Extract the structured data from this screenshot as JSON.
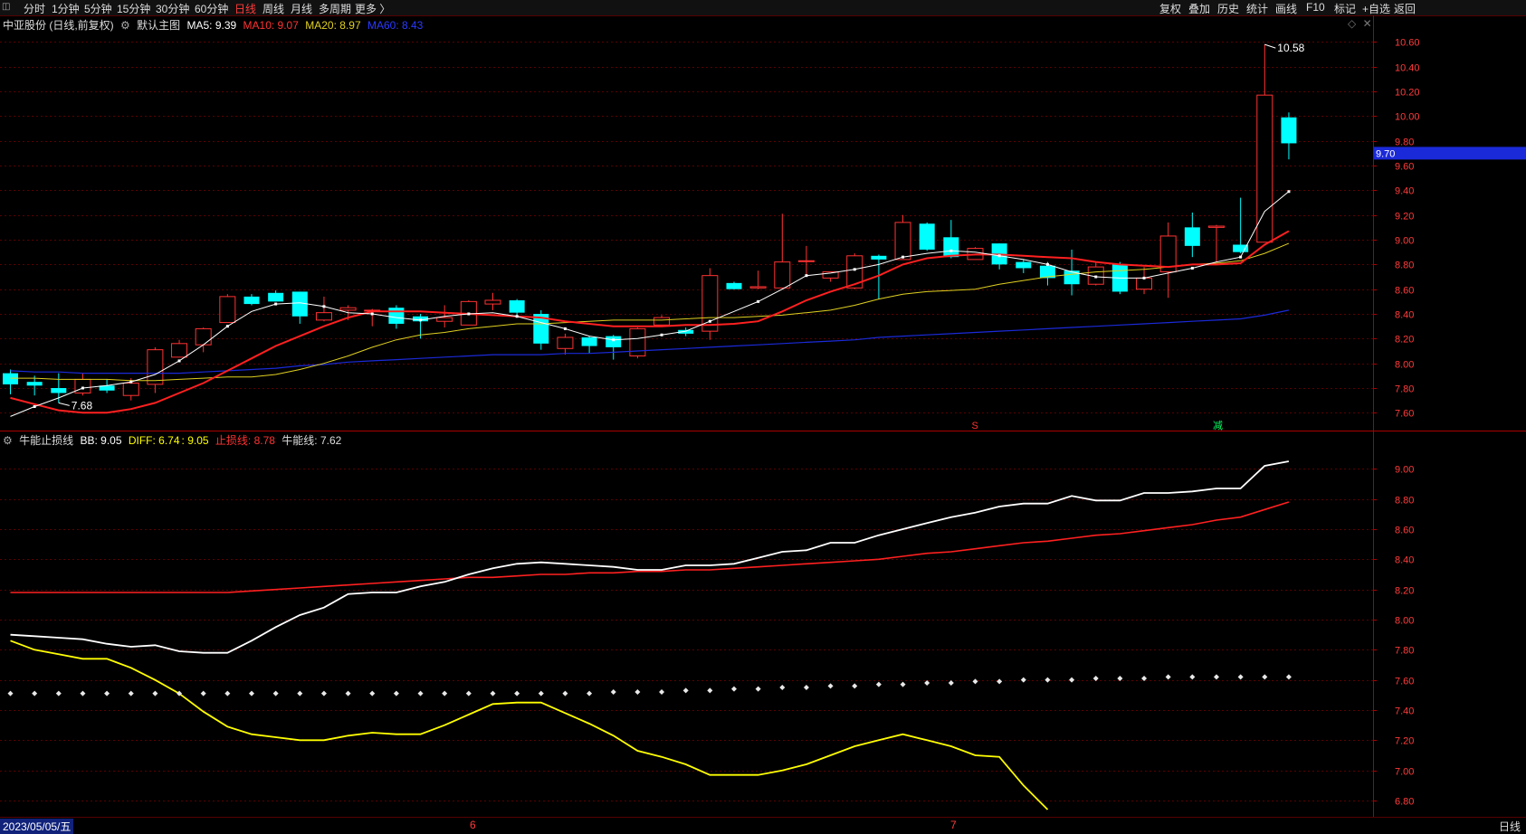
{
  "toolbar": {
    "tabs": [
      "分时",
      "1分钟",
      "5分钟",
      "15分钟",
      "30分钟",
      "60分钟",
      "日线",
      "周线",
      "月线",
      "多周期",
      "更多 〉"
    ],
    "active_tab": "日线",
    "right_tabs": [
      "复权",
      "叠加",
      "历史",
      "统计",
      "画线",
      "F10",
      "标记",
      "+自选",
      "返回"
    ]
  },
  "main_legend": {
    "stock": "中亚股份 (日线,前复权)",
    "template": "默认主图",
    "ma5": "MA5: 9.39",
    "ma10": "MA10: 9.07",
    "ma20": "MA20: 8.97",
    "ma60": "MA60: 8.43"
  },
  "sub_legend": {
    "name": "牛能止损线",
    "bb": "BB: 9.05",
    "diff": "DIFF: 6.74",
    "diff2": ": 9.05",
    "stop": "止损线: 8.78",
    "bull": "牛能线: 7.62"
  },
  "bottom": {
    "date": "2023/05/05/五",
    "month_6": "6",
    "month_7": "7",
    "period": "日线"
  },
  "colors": {
    "up": "#ff3232",
    "down": "#00ffff",
    "ma5": "#ffffff",
    "ma10": "#ff2020",
    "ma20": "#e0d020",
    "ma60": "#1a2ad8",
    "diff": "#ffff00",
    "bb": "#ffffff",
    "stop": "#ff2020"
  },
  "chart_data": [
    {
      "type": "candlestick",
      "y_ticks": [
        "10.60",
        "10.40",
        "10.20",
        "10.00",
        "9.80",
        "9.60",
        "9.40",
        "9.20",
        "9.00",
        "8.80",
        "8.60",
        "8.40",
        "8.20",
        "8.00",
        "7.80",
        "7.60"
      ],
      "ylim": [
        7.5,
        10.72
      ],
      "current_price_label": "9.70",
      "high_label": "10.58",
      "low_label": "7.68",
      "markers": [
        {
          "text": "S",
          "index": 40,
          "color": "#ff3232"
        },
        {
          "text": "减",
          "index": 50,
          "color": "#00ff66"
        }
      ],
      "candles": [
        {
          "o": 7.92,
          "h": 7.95,
          "l": 7.75,
          "c": 7.83
        },
        {
          "o": 7.85,
          "h": 7.9,
          "l": 7.74,
          "c": 7.82
        },
        {
          "o": 7.8,
          "h": 7.92,
          "l": 7.68,
          "c": 7.76
        },
        {
          "o": 7.76,
          "h": 7.92,
          "l": 7.74,
          "c": 7.87
        },
        {
          "o": 7.82,
          "h": 7.87,
          "l": 7.76,
          "c": 7.78
        },
        {
          "o": 7.74,
          "h": 7.88,
          "l": 7.7,
          "c": 7.84
        },
        {
          "o": 7.83,
          "h": 8.13,
          "l": 7.76,
          "c": 8.11
        },
        {
          "o": 8.05,
          "h": 8.19,
          "l": 8.05,
          "c": 8.16
        },
        {
          "o": 8.15,
          "h": 8.29,
          "l": 8.09,
          "c": 8.28
        },
        {
          "o": 8.33,
          "h": 8.56,
          "l": 8.33,
          "c": 8.54
        },
        {
          "o": 8.54,
          "h": 8.56,
          "l": 8.47,
          "c": 8.48
        },
        {
          "o": 8.57,
          "h": 8.59,
          "l": 8.5,
          "c": 8.5
        },
        {
          "o": 8.58,
          "h": 8.58,
          "l": 8.32,
          "c": 8.38
        },
        {
          "o": 8.35,
          "h": 8.54,
          "l": 8.34,
          "c": 8.41
        },
        {
          "o": 8.43,
          "h": 8.47,
          "l": 8.35,
          "c": 8.45
        },
        {
          "o": 8.43,
          "h": 8.44,
          "l": 8.3,
          "c": 8.43
        },
        {
          "o": 8.45,
          "h": 8.47,
          "l": 8.28,
          "c": 8.32
        },
        {
          "o": 8.38,
          "h": 8.4,
          "l": 8.2,
          "c": 8.34
        },
        {
          "o": 8.34,
          "h": 8.47,
          "l": 8.29,
          "c": 8.37
        },
        {
          "o": 8.31,
          "h": 8.51,
          "l": 8.31,
          "c": 8.5
        },
        {
          "o": 8.48,
          "h": 8.57,
          "l": 8.43,
          "c": 8.51
        },
        {
          "o": 8.51,
          "h": 8.52,
          "l": 8.37,
          "c": 8.41
        },
        {
          "o": 8.4,
          "h": 8.43,
          "l": 8.11,
          "c": 8.16
        },
        {
          "o": 8.12,
          "h": 8.24,
          "l": 8.07,
          "c": 8.21
        },
        {
          "o": 8.21,
          "h": 8.22,
          "l": 8.08,
          "c": 8.14
        },
        {
          "o": 8.22,
          "h": 8.23,
          "l": 8.03,
          "c": 8.13
        },
        {
          "o": 8.06,
          "h": 8.29,
          "l": 8.04,
          "c": 8.28
        },
        {
          "o": 8.31,
          "h": 8.39,
          "l": 8.31,
          "c": 8.37
        },
        {
          "o": 8.27,
          "h": 8.29,
          "l": 8.22,
          "c": 8.24
        },
        {
          "o": 8.26,
          "h": 8.77,
          "l": 8.19,
          "c": 8.71
        },
        {
          "o": 8.65,
          "h": 8.66,
          "l": 8.6,
          "c": 8.6
        },
        {
          "o": 8.61,
          "h": 8.75,
          "l": 8.6,
          "c": 8.62
        },
        {
          "o": 8.61,
          "h": 9.21,
          "l": 8.6,
          "c": 8.82
        },
        {
          "o": 8.83,
          "h": 8.95,
          "l": 8.7,
          "c": 8.83
        },
        {
          "o": 8.69,
          "h": 8.74,
          "l": 8.66,
          "c": 8.74
        },
        {
          "o": 8.61,
          "h": 8.89,
          "l": 8.6,
          "c": 8.87
        },
        {
          "o": 8.87,
          "h": 8.88,
          "l": 8.52,
          "c": 8.84
        },
        {
          "o": 8.84,
          "h": 9.2,
          "l": 8.84,
          "c": 9.14
        },
        {
          "o": 9.13,
          "h": 9.14,
          "l": 8.91,
          "c": 8.92
        },
        {
          "o": 9.02,
          "h": 9.16,
          "l": 8.85,
          "c": 8.86
        },
        {
          "o": 8.84,
          "h": 8.94,
          "l": 8.84,
          "c": 8.93
        },
        {
          "o": 8.97,
          "h": 8.97,
          "l": 8.76,
          "c": 8.8
        },
        {
          "o": 8.82,
          "h": 8.84,
          "l": 8.73,
          "c": 8.77
        },
        {
          "o": 8.79,
          "h": 8.82,
          "l": 8.63,
          "c": 8.69
        },
        {
          "o": 8.75,
          "h": 8.92,
          "l": 8.55,
          "c": 8.64
        },
        {
          "o": 8.64,
          "h": 8.82,
          "l": 8.63,
          "c": 8.78
        },
        {
          "o": 8.8,
          "h": 8.82,
          "l": 8.56,
          "c": 8.58
        },
        {
          "o": 8.6,
          "h": 8.78,
          "l": 8.56,
          "c": 8.69
        },
        {
          "o": 8.74,
          "h": 9.14,
          "l": 8.53,
          "c": 9.03
        },
        {
          "o": 9.1,
          "h": 9.22,
          "l": 8.86,
          "c": 8.95
        },
        {
          "o": 9.1,
          "h": 9.12,
          "l": 8.82,
          "c": 9.11
        },
        {
          "o": 8.96,
          "h": 9.34,
          "l": 8.89,
          "c": 8.9
        },
        {
          "o": 8.98,
          "h": 10.58,
          "l": 8.98,
          "c": 10.17
        },
        {
          "o": 9.99,
          "h": 10.03,
          "l": 9.65,
          "c": 9.78
        }
      ],
      "ma5": [
        7.57,
        7.65,
        7.72,
        7.8,
        7.82,
        7.85,
        7.91,
        8.02,
        8.15,
        8.3,
        8.42,
        8.48,
        8.49,
        8.46,
        8.41,
        8.4,
        8.37,
        8.35,
        8.38,
        8.4,
        8.41,
        8.38,
        8.33,
        8.28,
        8.22,
        8.19,
        8.2,
        8.23,
        8.26,
        8.34,
        8.42,
        8.5,
        8.6,
        8.71,
        8.73,
        8.76,
        8.8,
        8.86,
        8.89,
        8.91,
        8.9,
        8.87,
        8.84,
        8.8,
        8.74,
        8.7,
        8.69,
        8.69,
        8.73,
        8.77,
        8.82,
        8.86,
        9.23,
        9.39
      ],
      "ma10": [
        7.72,
        7.67,
        7.62,
        7.6,
        7.6,
        7.63,
        7.68,
        7.76,
        7.84,
        7.94,
        8.04,
        8.14,
        8.22,
        8.3,
        8.37,
        8.42,
        8.42,
        8.42,
        8.41,
        8.4,
        8.39,
        8.38,
        8.37,
        8.34,
        8.32,
        8.3,
        8.3,
        8.3,
        8.31,
        8.31,
        8.32,
        8.34,
        8.42,
        8.51,
        8.58,
        8.64,
        8.71,
        8.8,
        8.85,
        8.87,
        8.88,
        8.88,
        8.87,
        8.86,
        8.85,
        8.82,
        8.8,
        8.79,
        8.78,
        8.8,
        8.8,
        8.81,
        8.96,
        9.07
      ],
      "ma20": [
        7.88,
        7.88,
        7.87,
        7.87,
        7.87,
        7.86,
        7.86,
        7.87,
        7.88,
        7.89,
        7.89,
        7.91,
        7.95,
        8.0,
        8.06,
        8.13,
        8.19,
        8.23,
        8.25,
        8.28,
        8.3,
        8.32,
        8.32,
        8.33,
        8.34,
        8.35,
        8.35,
        8.35,
        8.36,
        8.37,
        8.37,
        8.38,
        8.39,
        8.41,
        8.43,
        8.47,
        8.52,
        8.56,
        8.58,
        8.59,
        8.6,
        8.64,
        8.67,
        8.7,
        8.72,
        8.74,
        8.75,
        8.76,
        8.78,
        8.8,
        8.81,
        8.83,
        8.89,
        8.97
      ],
      "ma60": [
        7.94,
        7.93,
        7.93,
        7.92,
        7.92,
        7.92,
        7.92,
        7.92,
        7.93,
        7.94,
        7.95,
        7.96,
        7.98,
        7.99,
        8.01,
        8.02,
        8.03,
        8.04,
        8.05,
        8.06,
        8.07,
        8.07,
        8.07,
        8.08,
        8.08,
        8.09,
        8.1,
        8.11,
        8.12,
        8.13,
        8.14,
        8.15,
        8.16,
        8.17,
        8.18,
        8.19,
        8.21,
        8.22,
        8.23,
        8.24,
        8.25,
        8.26,
        8.27,
        8.28,
        8.29,
        8.3,
        8.31,
        8.32,
        8.33,
        8.34,
        8.35,
        8.36,
        8.39,
        8.43
      ]
    },
    {
      "type": "line",
      "y_ticks": [
        "9.00",
        "8.80",
        "8.60",
        "8.40",
        "8.20",
        "8.00",
        "7.80",
        "7.60",
        "7.40",
        "7.20",
        "7.00",
        "6.80"
      ],
      "ylim": [
        6.71,
        9.17
      ],
      "series": [
        {
          "name": "BB",
          "values": [
            7.9,
            7.89,
            7.88,
            7.87,
            7.84,
            7.82,
            7.83,
            7.79,
            7.78,
            7.78,
            7.86,
            7.95,
            8.03,
            8.08,
            8.17,
            8.18,
            8.18,
            8.22,
            8.25,
            8.3,
            8.34,
            8.37,
            8.38,
            8.37,
            8.36,
            8.35,
            8.33,
            8.33,
            8.36,
            8.36,
            8.37,
            8.41,
            8.45,
            8.46,
            8.51,
            8.51,
            8.56,
            8.6,
            8.64,
            8.68,
            8.71,
            8.75,
            8.77,
            8.77,
            8.82,
            8.79,
            8.79,
            8.84,
            8.84,
            8.85,
            8.87,
            8.87,
            9.02,
            9.05
          ]
        },
        {
          "name": "止损线",
          "values": [
            8.18,
            8.18,
            8.18,
            8.18,
            8.18,
            8.18,
            8.18,
            8.18,
            8.18,
            8.18,
            8.19,
            8.2,
            8.21,
            8.22,
            8.23,
            8.24,
            8.25,
            8.26,
            8.27,
            8.28,
            8.28,
            8.29,
            8.3,
            8.3,
            8.31,
            8.31,
            8.32,
            8.32,
            8.33,
            8.33,
            8.34,
            8.35,
            8.36,
            8.37,
            8.38,
            8.39,
            8.4,
            8.42,
            8.44,
            8.45,
            8.47,
            8.49,
            8.51,
            8.52,
            8.54,
            8.56,
            8.57,
            8.59,
            8.61,
            8.63,
            8.66,
            8.68,
            8.73,
            8.78
          ]
        },
        {
          "name": "DIFF",
          "values": [
            7.86,
            7.8,
            7.77,
            7.74,
            7.74,
            7.68,
            7.6,
            7.51,
            7.39,
            7.29,
            7.24,
            7.22,
            7.2,
            7.2,
            7.23,
            7.25,
            7.24,
            7.24,
            7.3,
            7.37,
            7.44,
            7.45,
            7.45,
            7.38,
            7.31,
            7.23,
            7.13,
            7.09,
            7.04,
            6.97,
            6.97,
            6.97,
            7.0,
            7.04,
            7.1,
            7.16,
            7.2,
            7.24,
            7.2,
            7.16,
            7.1,
            7.09,
            6.9,
            6.74
          ]
        },
        {
          "name": "牛能线",
          "values": [
            7.51,
            7.51,
            7.51,
            7.51,
            7.51,
            7.51,
            7.51,
            7.51,
            7.51,
            7.51,
            7.51,
            7.51,
            7.51,
            7.51,
            7.51,
            7.51,
            7.51,
            7.51,
            7.51,
            7.51,
            7.51,
            7.51,
            7.51,
            7.51,
            7.51,
            7.52,
            7.52,
            7.52,
            7.53,
            7.53,
            7.54,
            7.54,
            7.55,
            7.55,
            7.56,
            7.56,
            7.57,
            7.57,
            7.58,
            7.58,
            7.59,
            7.59,
            7.6,
            7.6,
            7.6,
            7.61,
            7.61,
            7.61,
            7.62,
            7.62,
            7.62,
            7.62,
            7.62,
            7.62
          ]
        }
      ]
    }
  ]
}
